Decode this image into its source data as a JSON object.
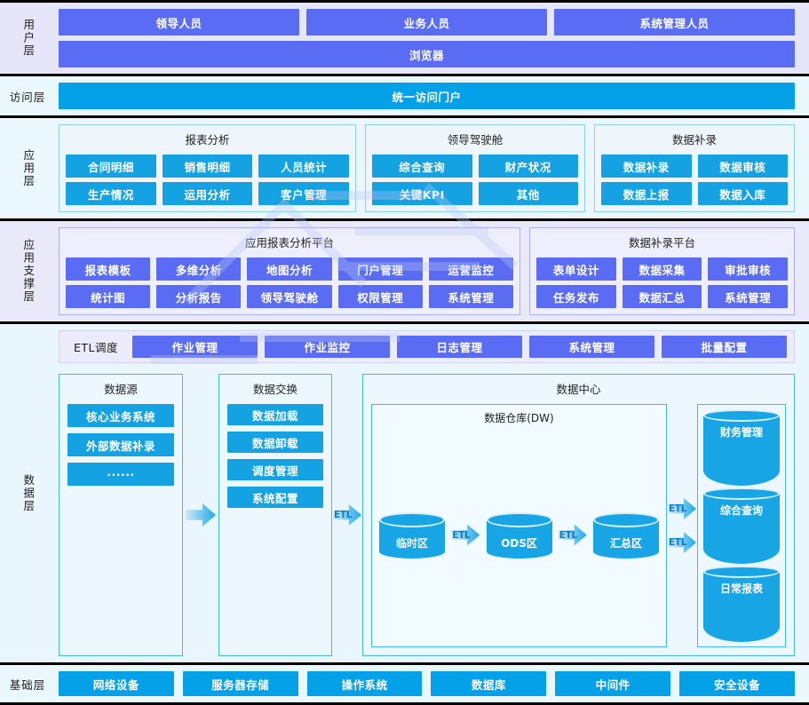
{
  "layers": {
    "user": {
      "label": "用户层",
      "roles": [
        "领导人员",
        "业务人员",
        "系统管理人员"
      ],
      "client": "浏览器"
    },
    "access": {
      "label": "访问层",
      "portal": "统一访问门户"
    },
    "application": {
      "label": "应用层",
      "groups": [
        {
          "title": "报表分析",
          "rows": [
            [
              "合同明细",
              "销售明细",
              "人员统计"
            ],
            [
              "生产情况",
              "运用分析",
              "客户管理"
            ]
          ]
        },
        {
          "title": "领导驾驶舱",
          "rows": [
            [
              "综合查询",
              "财产状况"
            ],
            [
              "关键KPI",
              "其他"
            ]
          ]
        },
        {
          "title": "数据补录",
          "rows": [
            [
              "数据补录",
              "数据审核"
            ],
            [
              "数据上报",
              "数据入库"
            ]
          ]
        }
      ]
    },
    "support": {
      "label": "应用支撑层",
      "groups": [
        {
          "title": "应用报表分析平台",
          "rows": [
            [
              "报表模板",
              "多维分析",
              "地图分析",
              "门户管理",
              "运营监控"
            ],
            [
              "统计图",
              "分析报告",
              "领导驾驶舱",
              "权限管理",
              "系统管理"
            ]
          ]
        },
        {
          "title": "数据补录平台",
          "rows": [
            [
              "表单设计",
              "数据采集",
              "审批审核"
            ],
            [
              "任务发布",
              "数据汇总",
              "系统管理"
            ]
          ]
        }
      ]
    },
    "data": {
      "label": "数据层",
      "etl_scheduling": {
        "label": "ETL调度",
        "items": [
          "作业管理",
          "作业监控",
          "日志管理",
          "系统管理",
          "批量配置"
        ]
      },
      "source": {
        "title": "数据源",
        "items": [
          "核心业务系统",
          "外部数据补录",
          "······"
        ]
      },
      "exchange": {
        "title": "数据交换",
        "items": [
          "数据加载",
          "数据卸载",
          "调度管理",
          "系统配置"
        ]
      },
      "center": {
        "title": "数据中心",
        "warehouse": {
          "title": "数据仓库(DW)",
          "zones": [
            "临时区",
            "ODS区",
            "汇总区"
          ],
          "arrow_labels": [
            "ETL",
            "ETL"
          ]
        },
        "marts": [
          "财务管理",
          "综合查询",
          "日常报表"
        ],
        "mart_arrow_labels": [
          "ETL",
          "ETL"
        ],
        "inflow_arrow_label": "ETL"
      }
    },
    "base": {
      "label": "基础层",
      "items": [
        "网络设备",
        "服务器存储",
        "操作系统",
        "数据库",
        "中间件",
        "安全设备"
      ]
    }
  },
  "colors": {
    "purple": "#5a6cf3",
    "cyan": "#14a2e2",
    "azure": "#05a1e8",
    "border_blue": "#44b6ef"
  }
}
